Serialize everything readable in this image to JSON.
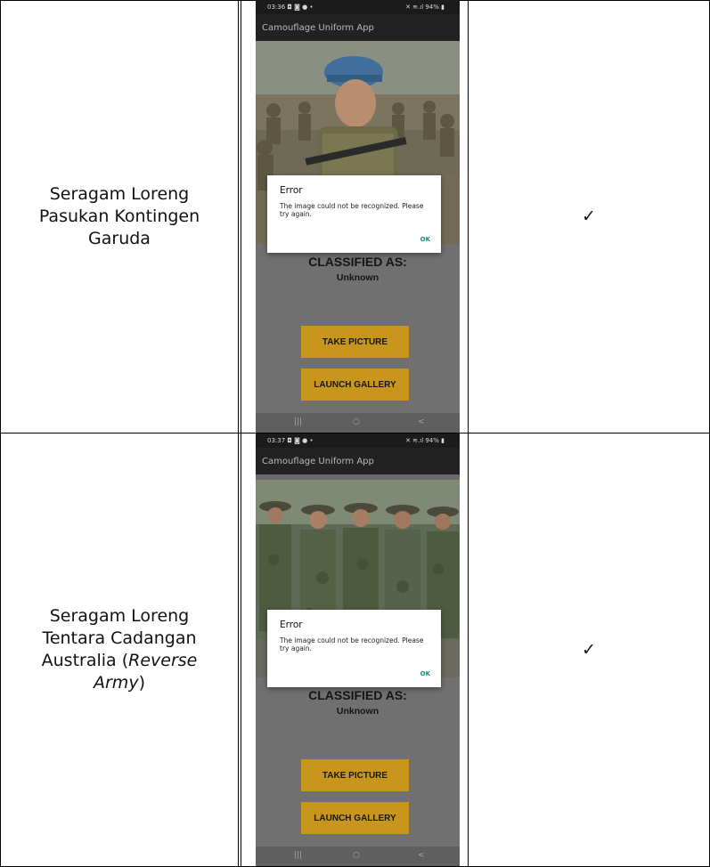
{
  "rows": [
    {
      "label_lines": [
        "Seragam Loreng",
        "Pasukan Kontingen",
        "Garuda"
      ],
      "check": "✓",
      "phone": {
        "status_time": "03:36 ◘ ◙ ● •",
        "status_right": "✕ ≋.ıl 94% ▮",
        "app_title": "Camouflage Uniform App",
        "classified_label": "CLASSIFIED AS:",
        "classified_value": "Unknown",
        "take_picture": "TAKE PICTURE",
        "launch_gallery": "LAUNCH GALLERY",
        "dialog_title": "Error",
        "dialog_message": "The image could not be recognized. Please try again.",
        "dialog_ok": "OK",
        "nav_recent": "|||",
        "nav_home": "○",
        "nav_back": "<"
      }
    },
    {
      "label_lines": [
        "Seragam Loreng",
        "Tentara Cadangan",
        "Australia (",
        "Reverse",
        "Army",
        ")"
      ],
      "check": "✓",
      "phone": {
        "status_time": "03:37 ◘ ◙ ● •",
        "status_right": "✕ ≋.ıl 94% ▮",
        "app_title": "Camouflage Uniform App",
        "classified_label": "CLASSIFIED AS:",
        "classified_value": "Unknown",
        "take_picture": "TAKE PICTURE",
        "launch_gallery": "LAUNCH GALLERY",
        "dialog_title": "Error",
        "dialog_message": "The image could not be recognized. Please try again.",
        "dialog_ok": "OK",
        "nav_recent": "|||",
        "nav_home": "○",
        "nav_back": "<"
      }
    }
  ],
  "colors": {
    "button": "#c8961c",
    "ok_text": "#1d8a7e",
    "appbar": "#222222"
  }
}
